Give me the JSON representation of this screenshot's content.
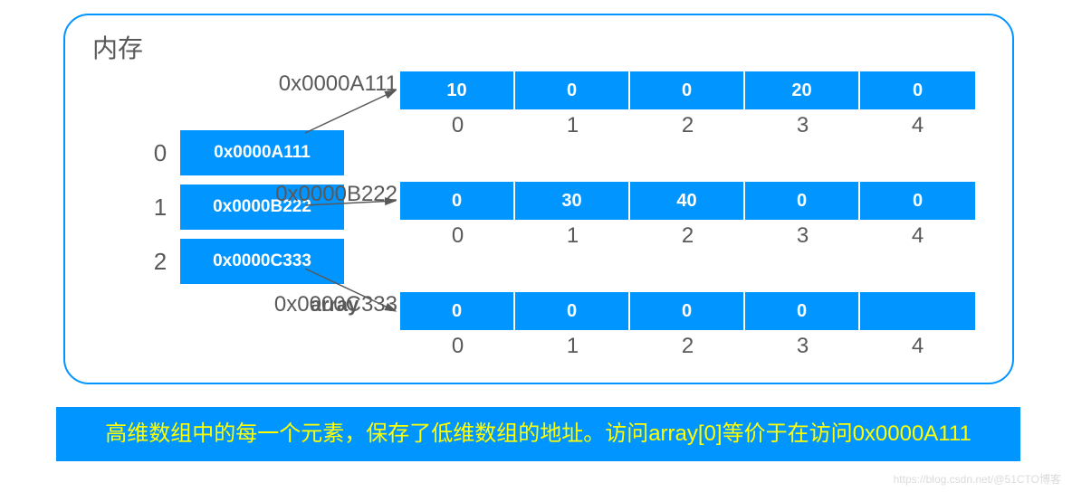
{
  "memory_title": "内存",
  "pointer_array": {
    "label": "array",
    "rows": [
      {
        "idx": "0",
        "addr": "0x0000A111"
      },
      {
        "idx": "1",
        "addr": "0x0000B222"
      },
      {
        "idx": "2",
        "addr": "0x0000C333"
      }
    ]
  },
  "data_arrays": [
    {
      "addr": "0x0000A111",
      "values": [
        "10",
        "0",
        "0",
        "20",
        "0"
      ],
      "indices": [
        "0",
        "1",
        "2",
        "3",
        "4"
      ]
    },
    {
      "addr": "0x0000B222",
      "values": [
        "0",
        "30",
        "40",
        "0",
        "0"
      ],
      "indices": [
        "0",
        "1",
        "2",
        "3",
        "4"
      ]
    },
    {
      "addr": "0x0000C333",
      "values": [
        "0",
        "0",
        "0",
        "0",
        ""
      ],
      "indices": [
        "0",
        "1",
        "2",
        "3",
        "4"
      ]
    }
  ],
  "banner_text": "高维数组中的每一个元素，保存了低维数组的地址。访问array[0]等价于在访问0x0000A111",
  "watermark": "https://blog.csdn.net/@51CTO博客"
}
